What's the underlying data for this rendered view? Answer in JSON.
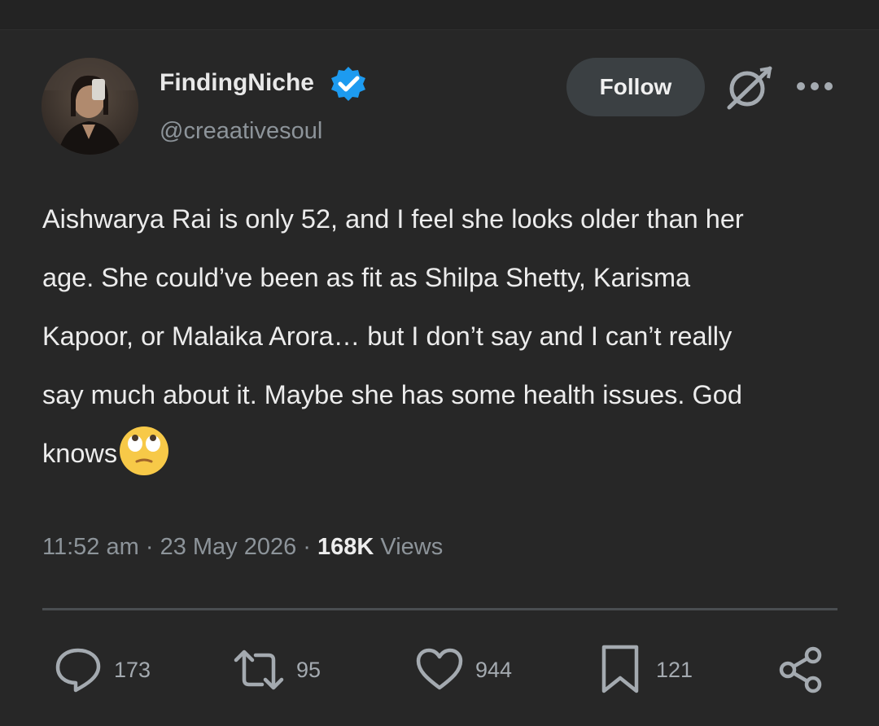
{
  "author": {
    "display_name": "FindingNiche",
    "handle": "@creaativesoul",
    "verified": true,
    "verified_color": "#1d9bf0"
  },
  "header": {
    "follow_label": "Follow",
    "grok_icon": "grok-icon",
    "more_icon": "more-horizontal-icon"
  },
  "tweet": {
    "lines": [
      "Aishwarya Rai is only 52, and I feel she looks older than her",
      "age. She could’ve been as fit as Shilpa Shetty, Karisma",
      "Kapoor, or Malaika Arora… but I don’t say and I can’t really",
      "say much about it. Maybe she has some health issues. God",
      "knows"
    ],
    "emoji": "face-with-rolling-eyes-emoji"
  },
  "meta": {
    "time": "11:52 am",
    "separator": "·",
    "date": "23 May 2026",
    "views_count": "168K",
    "views_label": "Views"
  },
  "actions": {
    "replies": "173",
    "retweets": "95",
    "likes": "944",
    "bookmarks": "121"
  },
  "colors": {
    "background": "#272727",
    "text": "#ececec",
    "secondary_text": "#8d949a",
    "icon": "#a4aab0",
    "follow_button_bg": "#3b4043"
  }
}
